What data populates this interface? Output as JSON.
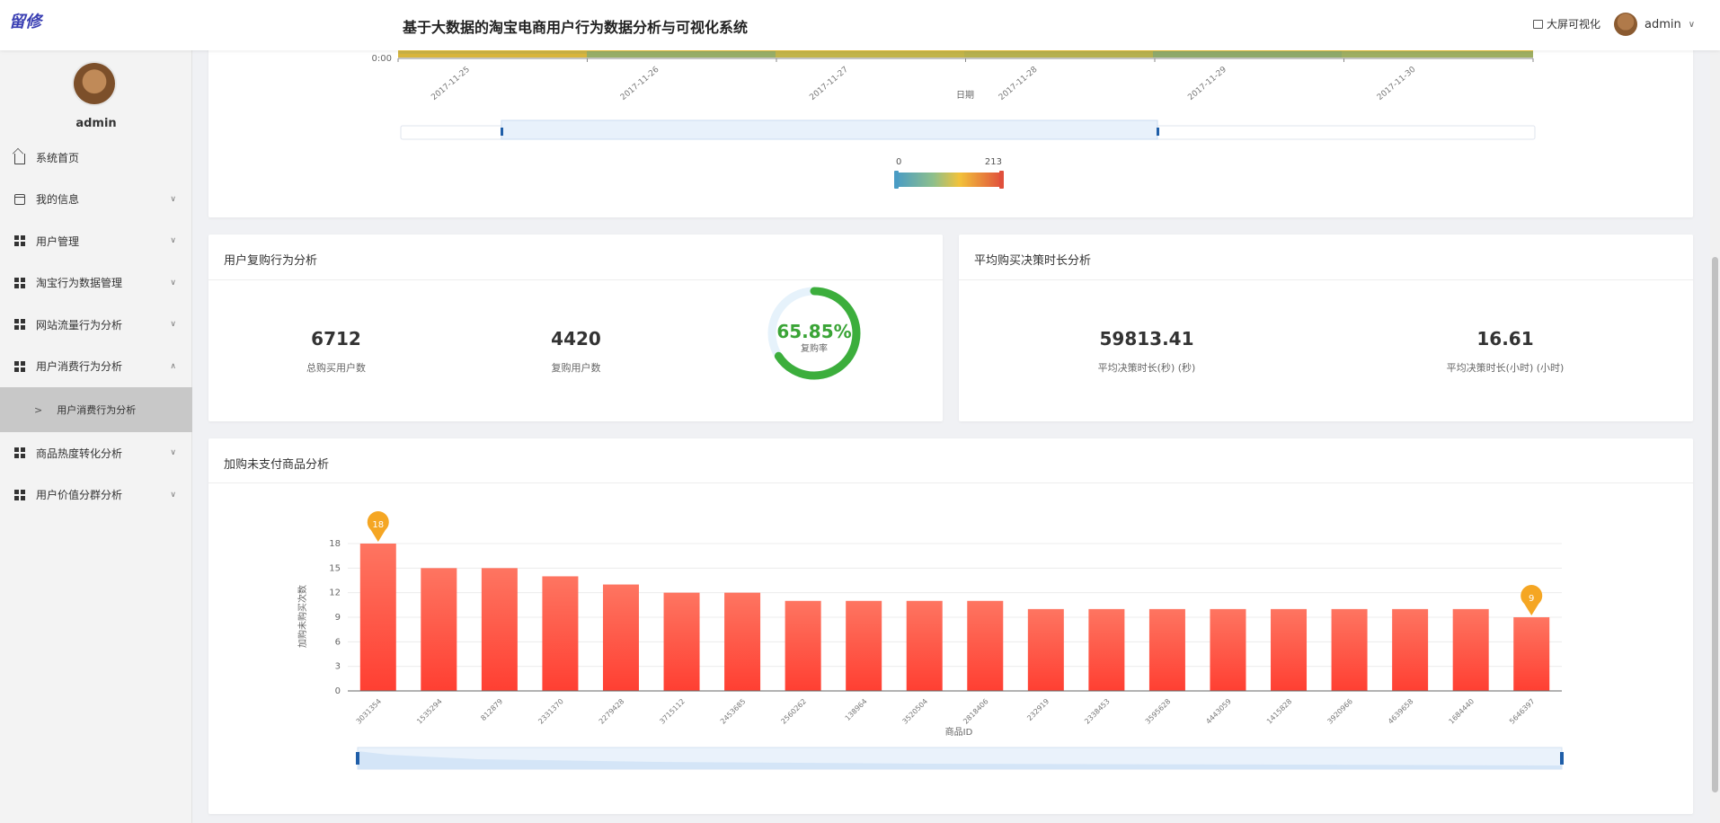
{
  "header": {
    "logo": "留修",
    "title": "基于大数据的淘宝电商用户行为数据分析与可视化系统",
    "big_screen": "大屏可视化",
    "user": "admin"
  },
  "sidebar": {
    "username": "admin",
    "items": [
      {
        "label": "系统首页",
        "icon": "home-icon"
      },
      {
        "label": "我的信息",
        "icon": "card-icon",
        "arrow": "∨"
      },
      {
        "label": "用户管理",
        "icon": "grid-icon",
        "arrow": "∨"
      },
      {
        "label": "淘宝行为数据管理",
        "icon": "grid-icon",
        "arrow": "∨"
      },
      {
        "label": "网站流量行为分析",
        "icon": "grid-icon",
        "arrow": "∨"
      },
      {
        "label": "用户消费行为分析",
        "icon": "grid-icon",
        "arrow": "∧"
      },
      {
        "label": "商品热度转化分析",
        "icon": "grid-icon",
        "arrow": "∨"
      },
      {
        "label": "用户价值分群分析",
        "icon": "grid-icon",
        "arrow": "∨"
      }
    ],
    "sub_item": "用户消费行为分析",
    "sub_arrow": ">"
  },
  "heatmap": {
    "y_tick": "0:00",
    "x_ticks": [
      "2017-11-25",
      "2017-11-26",
      "2017-11-27",
      "2017-11-28",
      "2017-11-29",
      "2017-11-30"
    ],
    "x_label": "日期",
    "visual_map_min": "0",
    "visual_map_max": "213"
  },
  "repurchase": {
    "title": "用户复购行为分析",
    "total_buyers": "6712",
    "total_buyers_label": "总购买用户数",
    "repeat_buyers": "4420",
    "repeat_buyers_label": "复购用户数",
    "rate_text": "65.85%",
    "rate": 0.6585,
    "rate_label": "复购率"
  },
  "decision": {
    "title": "平均购买决策时长分析",
    "seconds": "59813.41",
    "seconds_label": "平均决策时长(秒) (秒)",
    "hours": "16.61",
    "hours_label": "平均决策时长(小时) (小时)"
  },
  "cart_panel": {
    "title": "加购未支付商品分析"
  },
  "chart_data": {
    "type": "bar",
    "title": "",
    "xlabel": "商品ID",
    "ylabel": "加购未购买次数",
    "ylim": [
      0,
      18
    ],
    "y_ticks": [
      "0",
      "3",
      "6",
      "9",
      "12",
      "15",
      "18"
    ],
    "categories": [
      "3031354",
      "1535294",
      "812879",
      "2331370",
      "2279428",
      "3715112",
      "2453685",
      "2560262",
      "138964",
      "3520504",
      "2818406",
      "232919",
      "2338453",
      "3595628",
      "4443059",
      "1415828",
      "3920966",
      "4639658",
      "1684440",
      "5646397"
    ],
    "values": [
      18,
      15,
      15,
      14,
      13,
      12,
      12,
      11,
      11,
      11,
      11,
      10,
      10,
      10,
      10,
      10,
      10,
      10,
      10,
      9
    ],
    "markers": [
      {
        "label": "18",
        "index": 0
      },
      {
        "label": "9",
        "index": 19
      }
    ],
    "bar_color_top": "#fe7561",
    "bar_color_bottom": "#ff3f32",
    "marker_color": "#f5a623"
  }
}
